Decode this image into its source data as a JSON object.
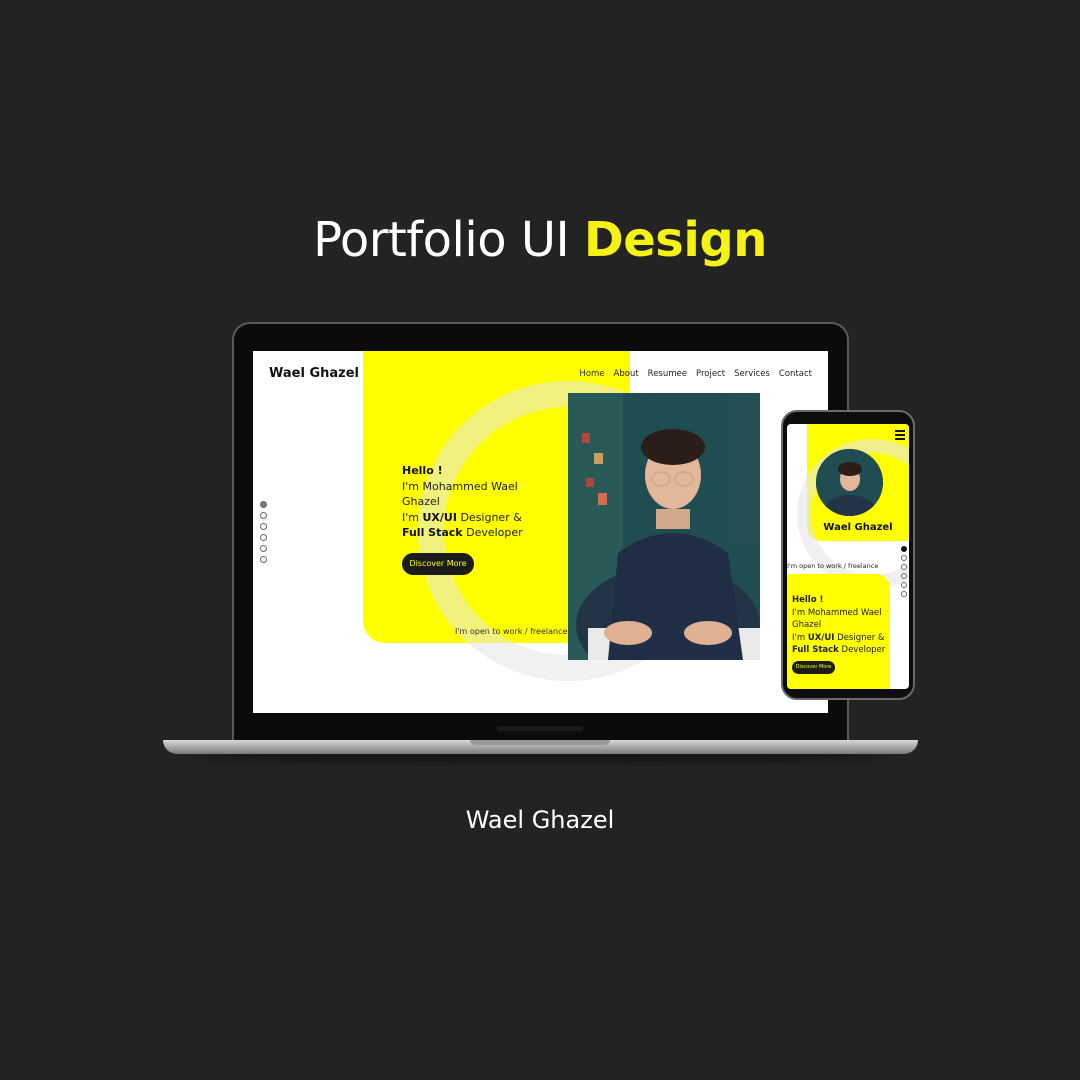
{
  "headline": {
    "prefix": "Portfolio UI",
    "accent": "Design"
  },
  "author": "Wael Ghazel",
  "colors": {
    "background": "#232323",
    "accent": "#ffff00",
    "headline_accent": "#f5f214"
  },
  "desktop": {
    "brand": "Wael Ghazel",
    "nav": [
      "Home",
      "About",
      "Resumee",
      "Project",
      "Services",
      "Contact"
    ],
    "hero": {
      "greeting": "Hello !",
      "line1": "I'm Mohammed Wael Ghazel",
      "line2_prefix": "I'm",
      "line2_bold": "UX/UI",
      "line2_suffix": "Designer &",
      "line3_bold": "Full Stack",
      "line3_suffix": "Developer"
    },
    "cta": "Discover More",
    "status": "I'm open to work / freelance",
    "slide_dots": 6,
    "active_dot": 0
  },
  "mobile": {
    "name": "Wael Ghazel",
    "status": "I'm open to work / freelance",
    "hero": {
      "greeting": "Hello !",
      "line1": "I'm Mohammed Wael Ghazel",
      "line2_prefix": "I'm",
      "line2_bold": "UX/UI",
      "line2_suffix": "Designer &",
      "line3_bold": "Full Stack",
      "line3_suffix": "Developer"
    },
    "cta": "Discover More",
    "menu_icon": "hamburger-icon",
    "slide_dots": 6,
    "active_dot": 0
  }
}
